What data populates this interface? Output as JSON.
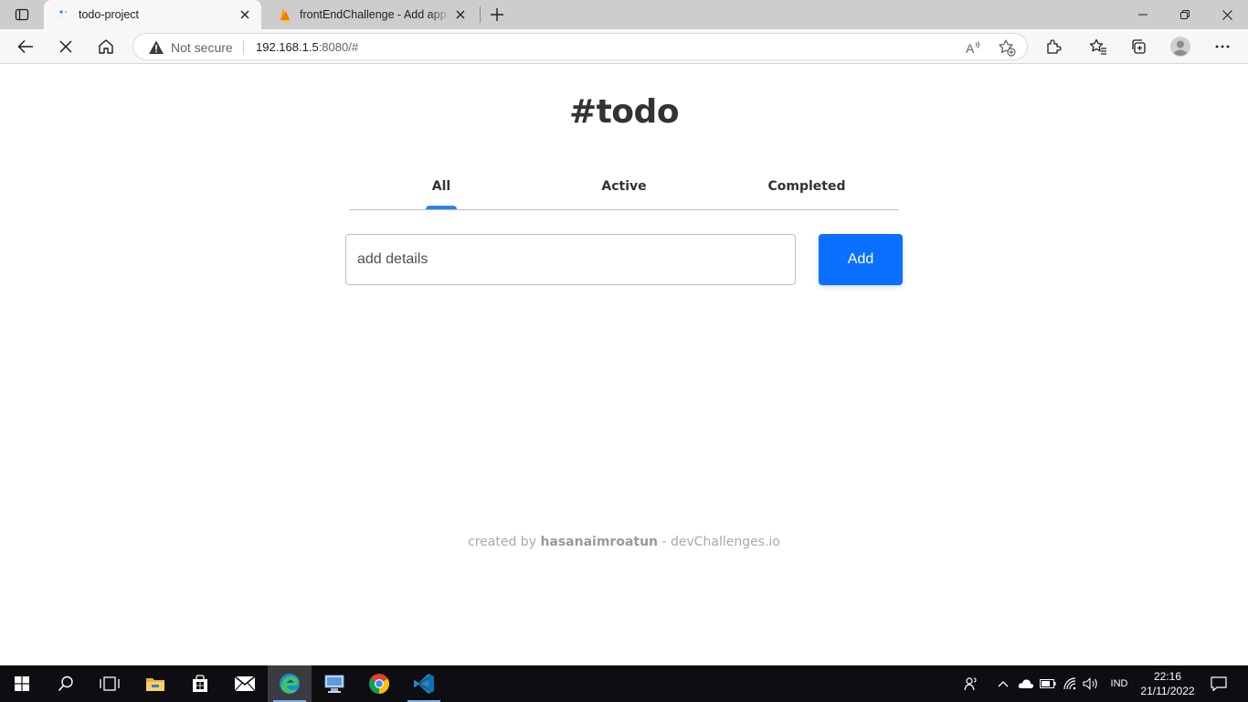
{
  "browser": {
    "tabs": [
      {
        "title": "todo-project",
        "active": true
      },
      {
        "title": "frontEndChallenge - Add app - F",
        "active": false
      }
    ],
    "address_bar": {
      "security_label": "Not secure",
      "url_host": "192.168.1.5",
      "url_rest": ":8080/#"
    }
  },
  "app": {
    "title": "#todo",
    "filters": [
      "All",
      "Active",
      "Completed"
    ],
    "selected_filter": "All",
    "input": {
      "value": "",
      "placeholder": "add details"
    },
    "add_label": "Add",
    "accent_color": "#2f80ed",
    "button_color": "#0b6fff"
  },
  "footer": {
    "prefix": "created by",
    "author": "hasanaimroatun",
    "suffix": "- devChallenges.io"
  },
  "taskbar": {
    "apps": [
      "start",
      "search",
      "task-view",
      "file-explorer",
      "microsoft-store",
      "mail",
      "edge",
      "remote-desktop",
      "chrome",
      "vscode"
    ],
    "active_app": "edge",
    "language": "IND",
    "time": "22:16",
    "date": "21/11/2022"
  }
}
